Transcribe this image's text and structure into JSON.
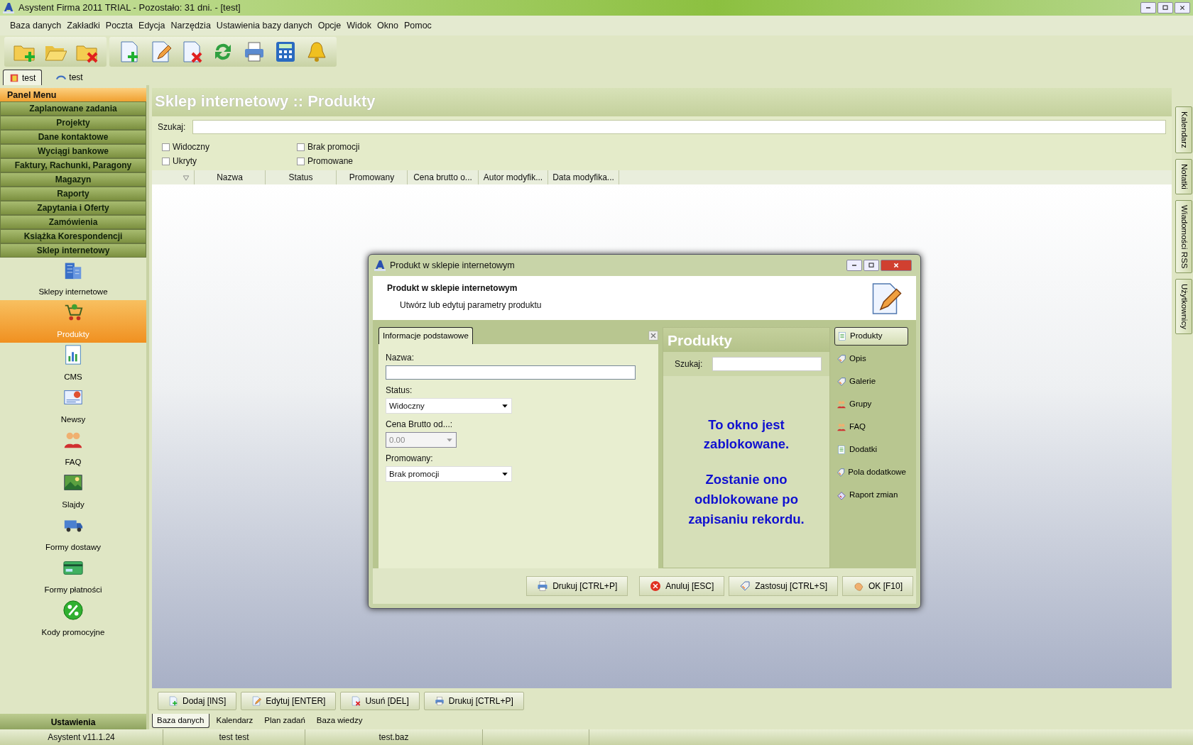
{
  "window": {
    "title": "Asystent Firma 2011 TRIAL - Pozostało: 31 dni. - [test]"
  },
  "menu": [
    "Baza danych",
    "Zakładki",
    "Poczta",
    "Edycja",
    "Narzędzia",
    "Ustawienia bazy danych",
    "Opcje",
    "Widok",
    "Okno",
    "Pomoc"
  ],
  "toolbar": [
    {
      "kind": "folder-add"
    },
    {
      "kind": "folder-open"
    },
    {
      "kind": "folder-delete"
    },
    {
      "kind": "sep"
    },
    {
      "kind": "doc-add"
    },
    {
      "kind": "doc-edit"
    },
    {
      "kind": "doc-delete"
    },
    {
      "kind": "refresh"
    },
    {
      "kind": "printer"
    },
    {
      "kind": "calculator"
    },
    {
      "kind": "bell"
    }
  ],
  "document_tabs": [
    {
      "label": "test",
      "selected": true
    },
    {
      "label": "test",
      "selected": false
    }
  ],
  "panel_menu": {
    "title": "Panel Menu",
    "categories": [
      {
        "label": "Zaplanowane zadania"
      },
      {
        "label": "Projekty"
      },
      {
        "label": "Dane kontaktowe"
      },
      {
        "label": "Wyciągi bankowe"
      },
      {
        "label": "Faktury, Rachunki, Paragony"
      },
      {
        "label": "Magazyn"
      },
      {
        "label": "Raporty"
      },
      {
        "label": "Zapytania i Oferty"
      },
      {
        "label": "Zamówienia"
      },
      {
        "label": "Książka Korespondencji"
      },
      {
        "label": "Sklep internetowy"
      }
    ],
    "items": [
      {
        "label": "Sklepy internetowe",
        "kind": "building",
        "selected": false
      },
      {
        "label": "Produkty",
        "kind": "cart",
        "selected": true
      },
      {
        "label": "CMS",
        "kind": "chart",
        "selected": false
      },
      {
        "label": "Newsy",
        "kind": "news",
        "selected": false
      },
      {
        "label": "FAQ",
        "kind": "people",
        "selected": false
      },
      {
        "label": "Slajdy",
        "kind": "picture",
        "selected": false
      },
      {
        "label": "Formy dostawy",
        "kind": "truck",
        "selected": false
      },
      {
        "label": "Formy płatności",
        "kind": "card",
        "selected": false
      },
      {
        "label": "Kody promocyjne",
        "kind": "percent",
        "selected": false
      }
    ],
    "footer": "Ustawienia"
  },
  "main": {
    "title": "Sklep internetowy :: Produkty",
    "search_label": "Szukaj:",
    "filters": [
      {
        "label": "Widoczny",
        "checked": false
      },
      {
        "label": "Brak promocji",
        "checked": false
      },
      {
        "label": "Ukryty",
        "checked": false
      },
      {
        "label": "Promowane",
        "checked": false
      }
    ],
    "columns": [
      "Nazwa",
      "Status",
      "Promowany",
      "Cena brutto o...",
      "Autor modyfik...",
      "Data modyfika..."
    ],
    "buttons": [
      {
        "label": "Dodaj [INS]",
        "kind": "add"
      },
      {
        "label": "Edytuj [ENTER]",
        "kind": "edit"
      },
      {
        "label": "Usuń [DEL]",
        "kind": "delete"
      },
      {
        "label": "Drukuj [CTRL+P]",
        "kind": "print"
      }
    ],
    "bottom_tabs": [
      {
        "label": "Baza danych",
        "selected": true
      },
      {
        "label": "Kalendarz",
        "selected": false
      },
      {
        "label": "Plan zadań",
        "selected": false
      },
      {
        "label": "Baza wiedzy",
        "selected": false
      }
    ]
  },
  "side_tabs": [
    "Kalendarz",
    "Notatki",
    "Wiadomości RSS",
    "Użytkownicy"
  ],
  "dialog": {
    "title": "Produkt w sklepie internetowym",
    "heading": "Produkt w sklepie internetowym",
    "subtitle": "Utwórz lub edytuj parametry produktu",
    "tab": {
      "label": "Informacje podstawowe",
      "selected": true
    },
    "fields": [
      {
        "label": "Nazwa:",
        "kind": "text",
        "disabled": false
      },
      {
        "label": "Status:",
        "kind": "select",
        "value": "Widoczny",
        "disabled": false
      },
      {
        "label": "Cena Brutto od...:",
        "kind": "combo",
        "value": "0.00",
        "disabled": true
      },
      {
        "label": "Promowany:",
        "kind": "select",
        "value": "Brak promocji",
        "disabled": false
      }
    ],
    "panel": {
      "title": "Produkty",
      "search_label": "Szukaj:",
      "message": [
        "To okno jest zablokowane.",
        "Zostanie ono odblokowane po zapisaniu rekordu."
      ]
    },
    "nav": [
      {
        "label": "Produkty",
        "kind": "list",
        "selected": true
      },
      {
        "label": "Opis",
        "kind": "tag",
        "selected": false
      },
      {
        "label": "Galerie",
        "kind": "tag",
        "selected": false
      },
      {
        "label": "Grupy",
        "kind": "people",
        "selected": false
      },
      {
        "label": "FAQ",
        "kind": "people",
        "selected": false
      },
      {
        "label": "Dodatki",
        "kind": "list",
        "selected": false
      },
      {
        "label": "Pola dodatkowe",
        "kind": "tag",
        "selected": false
      },
      {
        "label": "Raport zmian",
        "kind": "report",
        "selected": false
      }
    ],
    "buttons": [
      {
        "label": "Drukuj [CTRL+P]",
        "kind": "print"
      },
      {
        "label": "Anuluj [ESC]",
        "kind": "cancel"
      },
      {
        "label": "Zastosuj [CTRL+S]",
        "kind": "apply"
      },
      {
        "label": "OK [F10]",
        "kind": "ok"
      }
    ]
  },
  "status_bar": [
    "Asystent v11.1.24",
    "test test",
    "test.baz"
  ]
}
